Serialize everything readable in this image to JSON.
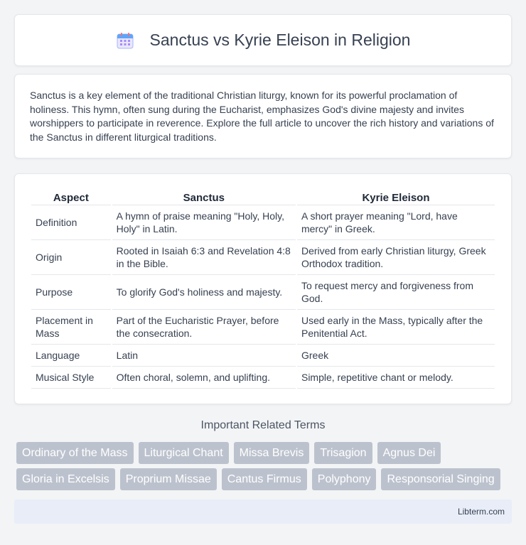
{
  "header": {
    "title": "Sanctus vs Kyrie Eleison in Religion",
    "icon": "calendar-icon"
  },
  "intro": {
    "text": "Sanctus is a key element of the traditional Christian liturgy, known for its powerful proclamation of holiness. This hymn, often sung during the Eucharist, emphasizes God's divine majesty and invites worshippers to participate in reverence. Explore the full article to uncover the rich history and variations of the Sanctus in different liturgical traditions."
  },
  "table": {
    "headers": [
      "Aspect",
      "Sanctus",
      "Kyrie Eleison"
    ],
    "rows": [
      [
        "Definition",
        "A hymn of praise meaning \"Holy, Holy, Holy\" in Latin.",
        "A short prayer meaning \"Lord, have mercy\" in Greek."
      ],
      [
        "Origin",
        "Rooted in Isaiah 6:3 and Revelation 4:8 in the Bible.",
        "Derived from early Christian liturgy, Greek Orthodox tradition."
      ],
      [
        "Purpose",
        "To glorify God's holiness and majesty.",
        "To request mercy and forgiveness from God."
      ],
      [
        "Placement in Mass",
        "Part of the Eucharistic Prayer, before the consecration.",
        "Used early in the Mass, typically after the Penitential Act."
      ],
      [
        "Language",
        "Latin",
        "Greek"
      ],
      [
        "Musical Style",
        "Often choral, solemn, and uplifting.",
        "Simple, repetitive chant or melody."
      ]
    ]
  },
  "related": {
    "title": "Important Related Terms",
    "row1": [
      "Ordinary of the Mass",
      "Liturgical Chant",
      "Missa Brevis",
      "Trisagion",
      "Agnus Dei"
    ],
    "row2": [
      "Gloria in Excelsis",
      "Proprium Missae",
      "Cantus Firmus",
      "Polyphony",
      "Responsorial Singing"
    ]
  },
  "footer": {
    "text": "Libterm.com"
  }
}
